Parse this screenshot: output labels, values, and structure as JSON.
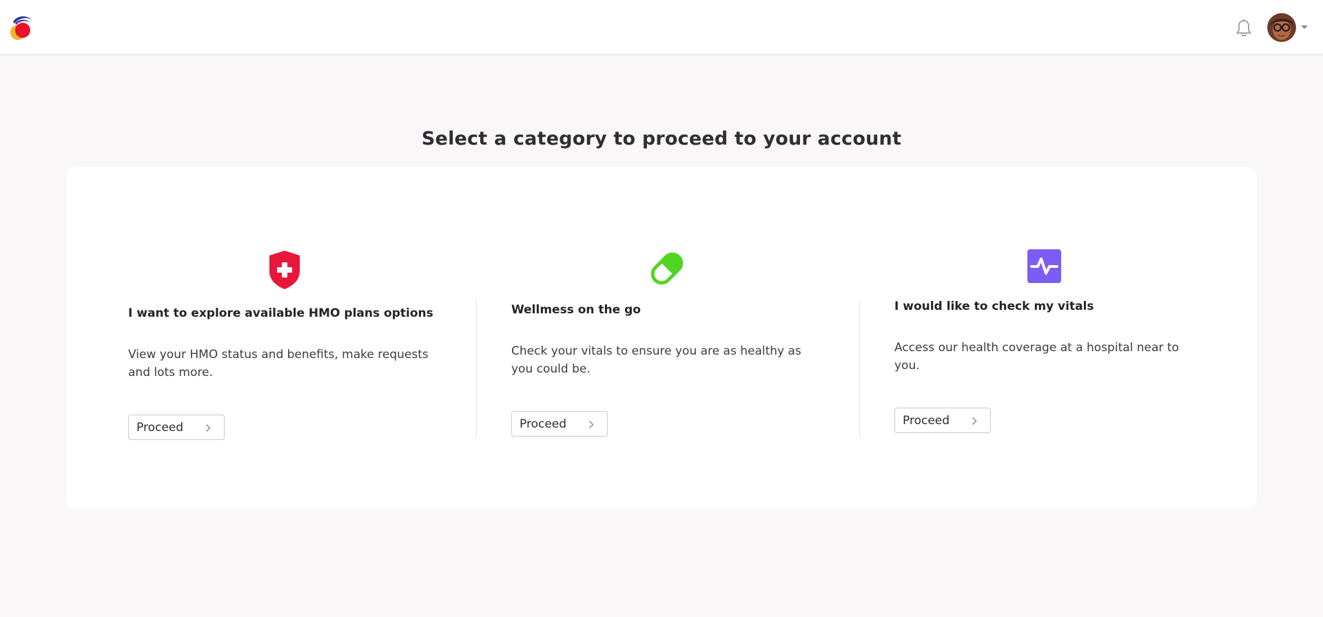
{
  "header": {
    "logo_icon": "app-logo",
    "notification_icon": "bell-icon",
    "avatar_icon": "user-avatar",
    "menu_icon": "caret-down-icon"
  },
  "main": {
    "title": "Select a category to proceed to your account",
    "categories": [
      {
        "icon": "shield-plus-icon",
        "icon_color": "#e8163a",
        "title": "I want to explore available HMO plans options",
        "description": "View your HMO status and benefits, make requests and lots more.",
        "button_label": "Proceed"
      },
      {
        "icon": "pill-icon",
        "icon_color": "#52d423",
        "title": "Wellmess on the go",
        "description": "Check your vitals to ensure you are as healthy as you could be.",
        "button_label": "Proceed"
      },
      {
        "icon": "pulse-icon",
        "icon_color": "#7b5cf5",
        "title": "I would like to check my vitals",
        "description": "Access our health coverage at a hospital near to you.",
        "button_label": "Proceed"
      }
    ]
  },
  "colors": {
    "background": "#f9f7f7",
    "card": "#ffffff",
    "text": "#2b2a33"
  }
}
